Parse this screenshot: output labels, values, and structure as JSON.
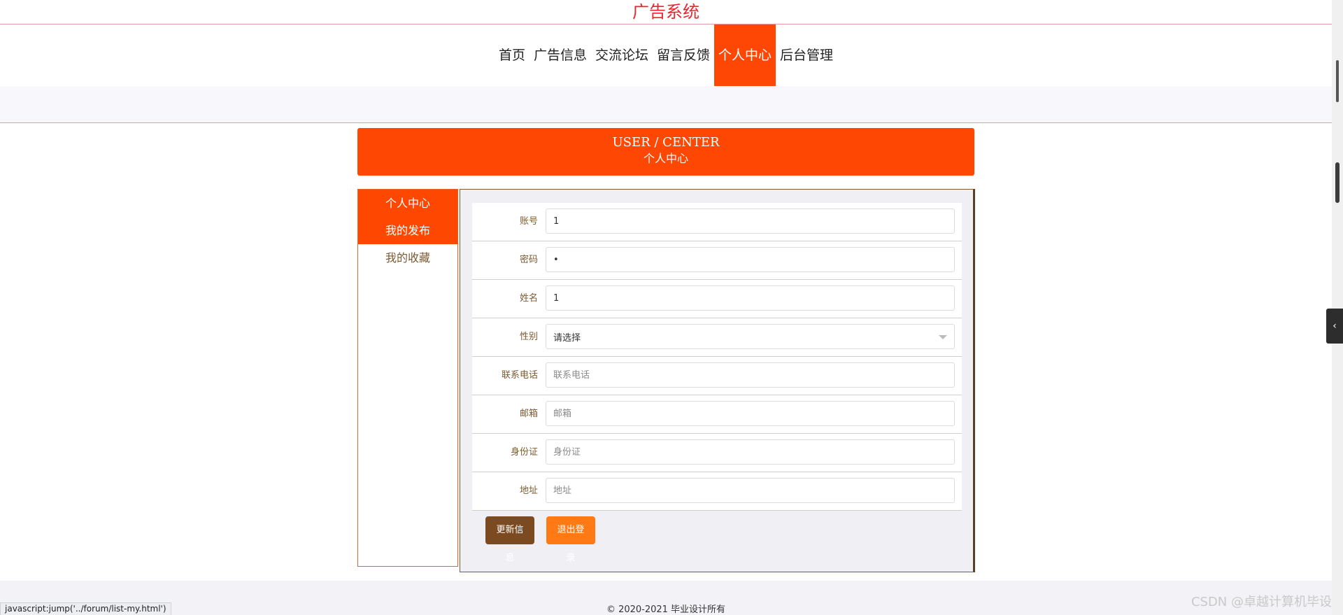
{
  "site_title": "广告系统",
  "nav": {
    "items": [
      {
        "label": "首页"
      },
      {
        "label": "广告信息"
      },
      {
        "label": "交流论坛"
      },
      {
        "label": "留言反馈"
      },
      {
        "label": "个人中心"
      },
      {
        "label": "后台管理"
      }
    ],
    "active_index": 4
  },
  "page_heading": {
    "en": "USER / CENTER",
    "cn": "个人中心"
  },
  "sidebar": {
    "items": [
      {
        "label": "个人中心"
      },
      {
        "label": "我的发布"
      },
      {
        "label": "我的收藏"
      }
    ]
  },
  "form": {
    "account": {
      "label": "账号",
      "value": "1"
    },
    "password": {
      "label": "密码",
      "value": "•"
    },
    "name": {
      "label": "姓名",
      "value": "1"
    },
    "gender": {
      "label": "性别",
      "selected": "请选择"
    },
    "phone": {
      "label": "联系电话",
      "placeholder": "联系电话"
    },
    "email": {
      "label": "邮箱",
      "placeholder": "邮箱"
    },
    "id_card": {
      "label": "身份证",
      "placeholder": "身份证"
    },
    "address": {
      "label": "地址",
      "placeholder": "地址"
    }
  },
  "buttons": {
    "update": "更新信息",
    "logout": "退出登录"
  },
  "footer": {
    "copyright": "© 2020-2021 毕业设计所有"
  },
  "status_bar": {
    "link": "javascript:jump('../forum/list-my.html')"
  },
  "watermark": "CSDN @卓越计算机毕设",
  "colors": {
    "accent": "#fe4702",
    "title_red": "#e8262d",
    "update_btn": "#7b4a21",
    "logout_btn": "#ff7a15"
  },
  "icons": {
    "select_caret": "chevron-down-icon",
    "side_toggle": "chevron-left-icon"
  }
}
